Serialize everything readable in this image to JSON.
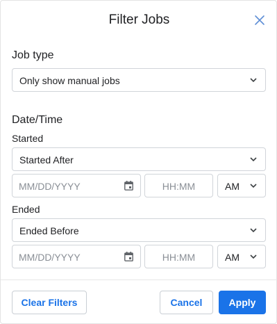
{
  "dialog": {
    "title": "Filter Jobs"
  },
  "job_type": {
    "label": "Job type",
    "selected": "Only show manual jobs"
  },
  "datetime": {
    "label": "Date/Time",
    "started": {
      "label": "Started",
      "mode": "Started After",
      "date_placeholder": "MM/DD/YYYY",
      "time_placeholder": "HH:MM",
      "ampm": "AM"
    },
    "ended": {
      "label": "Ended",
      "mode": "Ended Before",
      "date_placeholder": "MM/DD/YYYY",
      "time_placeholder": "HH:MM",
      "ampm": "AM"
    }
  },
  "footer": {
    "clear_label": "Clear Filters",
    "cancel_label": "Cancel",
    "apply_label": "Apply"
  },
  "colors": {
    "accent": "#1a73e8",
    "border": "#d0d4d9",
    "placeholder": "#8a8f96"
  },
  "icons": {
    "close": "close-icon",
    "dropdown": "chevron-down-icon",
    "calendar": "calendar-icon"
  }
}
